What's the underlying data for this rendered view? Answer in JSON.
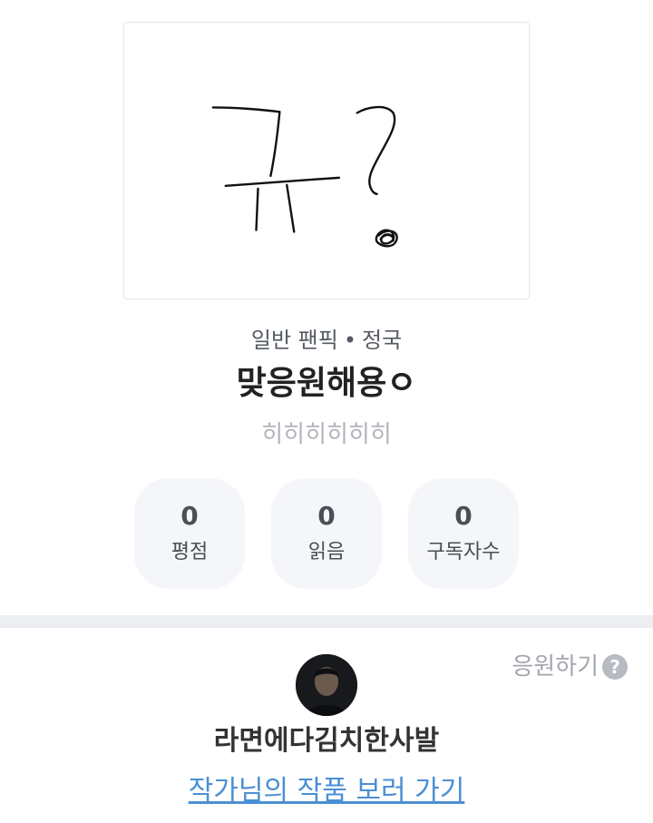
{
  "cover": {
    "description_icon": "handwritten-drawing"
  },
  "meta": {
    "category": "일반 팬픽",
    "separator": "•",
    "character": "정국"
  },
  "title": "맞응원해용ㅇ",
  "subtitle": "히히히히히히",
  "stats": [
    {
      "value": "0",
      "label": "평점"
    },
    {
      "value": "0",
      "label": "읽음"
    },
    {
      "value": "0",
      "label": "구독자수"
    }
  ],
  "support": {
    "label": "응원하기",
    "help_icon": "?"
  },
  "author": {
    "name": "라면에다김치한사발",
    "link_text": "작가님의 작품 보러 가기"
  },
  "colors": {
    "link": "#4a8fd4",
    "stat_bg": "#f4f6f9",
    "divider": "#eceef1"
  }
}
